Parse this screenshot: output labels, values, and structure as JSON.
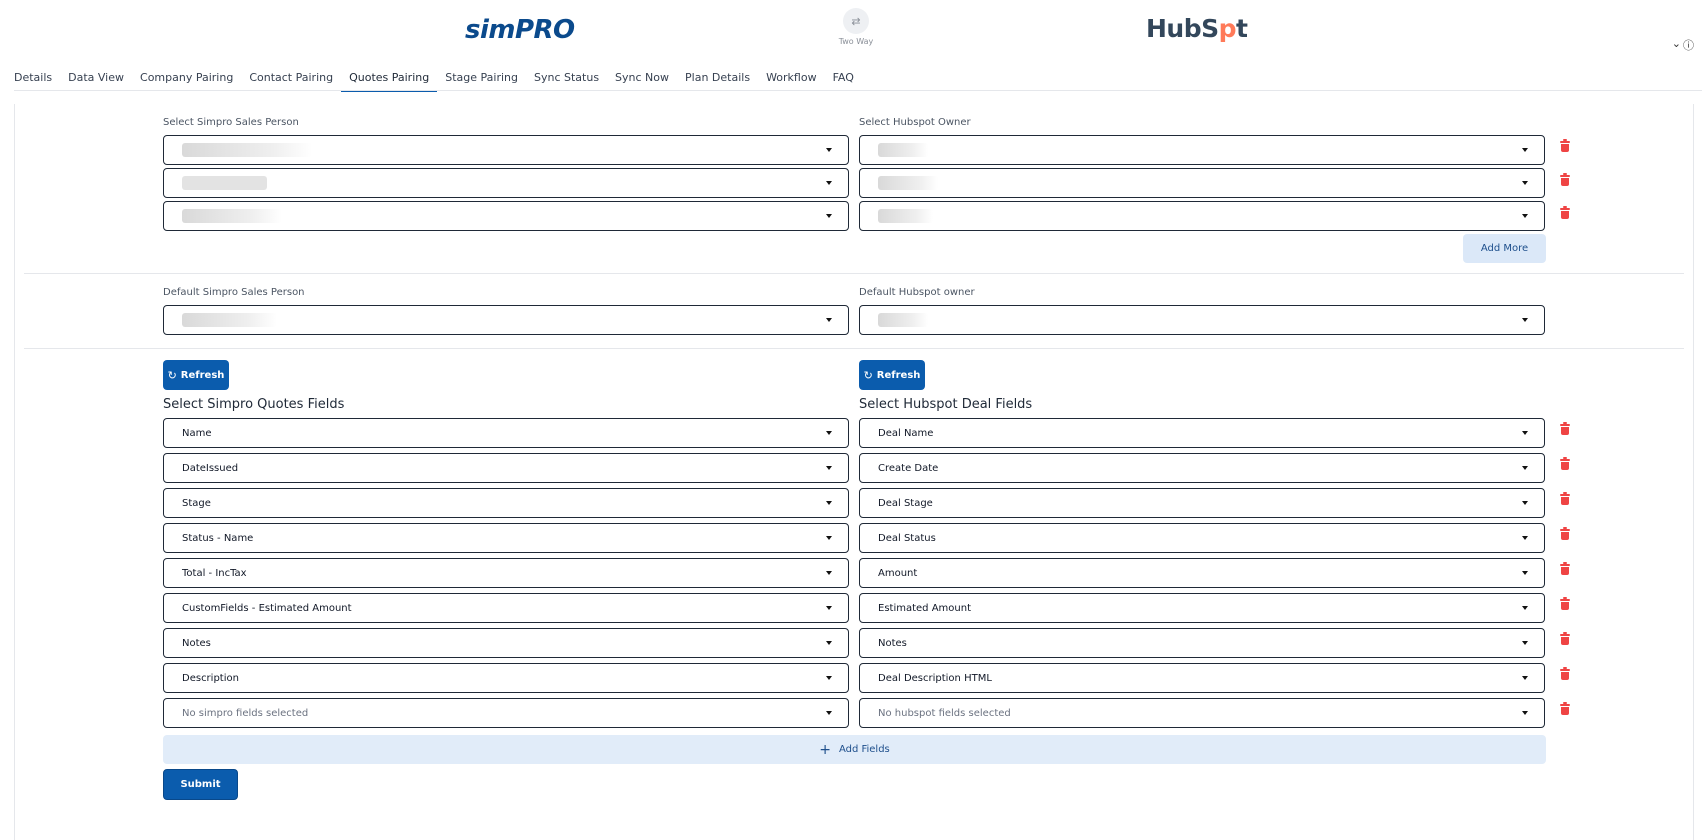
{
  "header": {
    "simpro_logo": "simPRO",
    "sync_icon": "⇄",
    "sync_label": "Two Way",
    "hubspot_logo_pre": "HubS",
    "hubspot_logo_sprocket": "p",
    "hubspot_logo_post": "t"
  },
  "tabs": [
    {
      "label": "Details"
    },
    {
      "label": "Data View"
    },
    {
      "label": "Company Pairing"
    },
    {
      "label": "Contact Pairing"
    },
    {
      "label": "Quotes Pairing",
      "active": true
    },
    {
      "label": "Stage Pairing"
    },
    {
      "label": "Sync Status"
    },
    {
      "label": "Sync Now"
    },
    {
      "label": "Plan Details"
    },
    {
      "label": "Workflow"
    },
    {
      "label": "FAQ"
    }
  ],
  "owners": {
    "simpro_label": "Select Simpro Sales Person",
    "hubspot_label": "Select Hubspot Owner",
    "add_more": "Add More"
  },
  "defaults": {
    "simpro_label": "Default Simpro Sales Person",
    "hubspot_label": "Default Hubspot owner"
  },
  "fields": {
    "refresh_label": "Refresh",
    "simpro_title": "Select Simpro Quotes Fields",
    "hubspot_title": "Select Hubspot Deal Fields",
    "rows": [
      {
        "simpro": "Name",
        "hubspot": "Deal Name"
      },
      {
        "simpro": "DateIssued",
        "hubspot": "Create Date"
      },
      {
        "simpro": "Stage",
        "hubspot": "Deal Stage"
      },
      {
        "simpro": "Status - Name",
        "hubspot": "Deal Status"
      },
      {
        "simpro": "Total - IncTax",
        "hubspot": "Amount"
      },
      {
        "simpro": "CustomFields - Estimated Amount",
        "hubspot": "Estimated Amount"
      },
      {
        "simpro": "Notes",
        "hubspot": "Notes"
      },
      {
        "simpro": "Description",
        "hubspot": "Deal Description HTML"
      }
    ],
    "empty_simpro": "No simpro fields selected",
    "empty_hubspot": "No hubspot fields selected",
    "add_fields": "Add Fields",
    "submit": "Submit"
  }
}
